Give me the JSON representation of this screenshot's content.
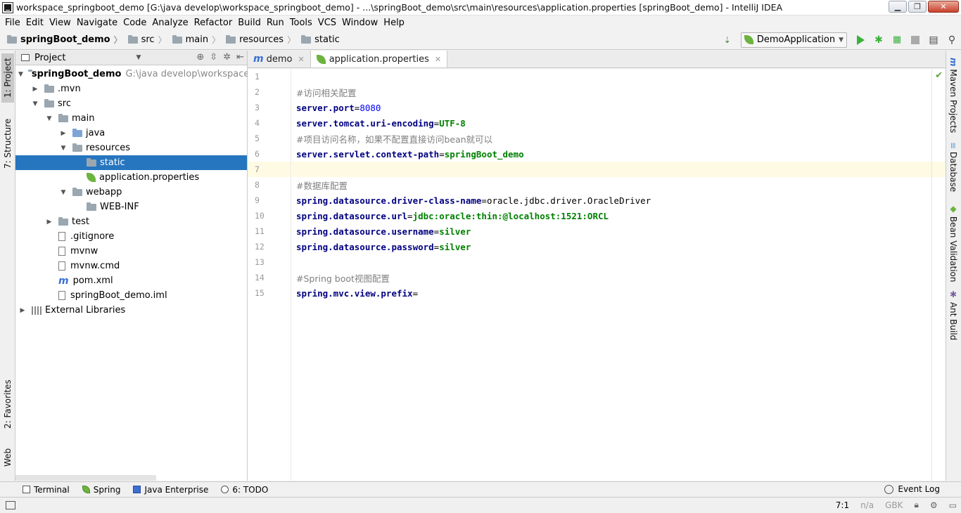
{
  "window": {
    "title": "workspace_springboot_demo [G:\\java develop\\workspace_springboot_demo] - ...\\springBoot_demo\\src\\main\\resources\\application.properties [springBoot_demo] - IntelliJ IDEA"
  },
  "menu": [
    "File",
    "Edit",
    "View",
    "Navigate",
    "Code",
    "Analyze",
    "Refactor",
    "Build",
    "Run",
    "Tools",
    "VCS",
    "Window",
    "Help"
  ],
  "breadcrumb": [
    "springBoot_demo",
    "src",
    "main",
    "resources",
    "static"
  ],
  "run_config": "DemoApplication",
  "left_tabs": {
    "project": "1: Project",
    "structure": "7: Structure",
    "favorites": "2: Favorites",
    "web": "Web"
  },
  "right_tabs": {
    "maven": "Maven Projects",
    "database": "Database",
    "bean": "Bean Validation",
    "ant": "Ant Build"
  },
  "project_panel": {
    "title": "Project",
    "root_label": "springBoot_demo",
    "root_path": "G:\\java develop\\workspace_sp",
    "items": [
      {
        "label": ".mvn"
      },
      {
        "label": "src"
      },
      {
        "label": "main"
      },
      {
        "label": "java"
      },
      {
        "label": "resources"
      },
      {
        "label": "static"
      },
      {
        "label": "application.properties"
      },
      {
        "label": "webapp"
      },
      {
        "label": "WEB-INF"
      },
      {
        "label": "test"
      },
      {
        "label": ".gitignore"
      },
      {
        "label": "mvnw"
      },
      {
        "label": "mvnw.cmd"
      },
      {
        "label": "pom.xml"
      },
      {
        "label": "springBoot_demo.iml"
      },
      {
        "label": "External Libraries"
      }
    ]
  },
  "editor_tabs": [
    {
      "label": "demo"
    },
    {
      "label": "application.properties"
    }
  ],
  "editor": {
    "line_numbers": [
      "1",
      "2",
      "3",
      "4",
      "5",
      "6",
      "7",
      "8",
      "9",
      "10",
      "11",
      "12",
      "13",
      "14",
      "15"
    ],
    "current_line": 7,
    "lines": [
      {
        "type": "empty"
      },
      {
        "type": "comment",
        "text": "#访问相关配置"
      },
      {
        "type": "prop",
        "key": "server.port",
        "value": "8080",
        "vclass": "n"
      },
      {
        "type": "prop",
        "key": "server.tomcat.uri-encoding",
        "value": "UTF-8",
        "vclass": "v"
      },
      {
        "type": "comment",
        "text": "#项目访问名称，如果不配置直接访问bean就可以"
      },
      {
        "type": "prop",
        "key": "server.servlet.context-path",
        "value": "springBoot_demo",
        "vclass": "v"
      },
      {
        "type": "empty"
      },
      {
        "type": "comment",
        "text": "#数据库配置"
      },
      {
        "type": "prop",
        "key": "spring.datasource.driver-class-name",
        "value": "oracle.jdbc.driver.OracleDriver",
        "vclass": "v-plain"
      },
      {
        "type": "prop",
        "key": "spring.datasource.url",
        "value": "jdbc:oracle:thin:@localhost:1521:ORCL",
        "vclass": "v"
      },
      {
        "type": "prop",
        "key": "spring.datasource.username",
        "value": "silver",
        "vclass": "v"
      },
      {
        "type": "prop",
        "key": "spring.datasource.password",
        "value": "silver",
        "vclass": "v"
      },
      {
        "type": "empty"
      },
      {
        "type": "comment",
        "text": "#Spring boot视图配置"
      },
      {
        "type": "prop",
        "key": "spring.mvc.view.prefix",
        "value": "",
        "vclass": "v"
      }
    ]
  },
  "bottom_tools": [
    "Terminal",
    "Spring",
    "Java Enterprise",
    "6: TODO"
  ],
  "event_log": "Event Log",
  "status": {
    "position": "7:1",
    "na": "n/a",
    "encoding": "GBK"
  }
}
